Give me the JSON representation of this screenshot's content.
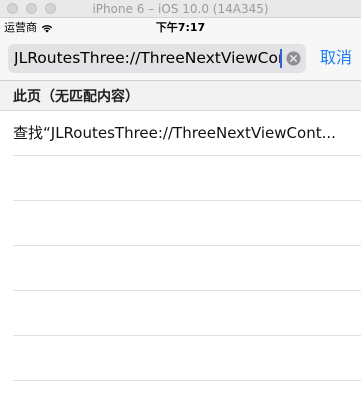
{
  "window": {
    "title": "iPhone 6 – iOS 10.0 (14A345)"
  },
  "status_bar": {
    "carrier": "运营商",
    "time": "下午7:17",
    "wifi_icon": "wifi-icon"
  },
  "search": {
    "query": "JLRoutesThree://ThreeNextViewContro",
    "clear_icon": "clear-icon",
    "cancel_label": "取消"
  },
  "results": {
    "section_title": "此页（无匹配内容）",
    "find_row_text": "查找“JLRoutesThree://ThreeNextViewCont..."
  },
  "colors": {
    "accent": "#1a7bf6",
    "caret": "#2f62d6",
    "search_field_bg": "#e3e3e6"
  }
}
